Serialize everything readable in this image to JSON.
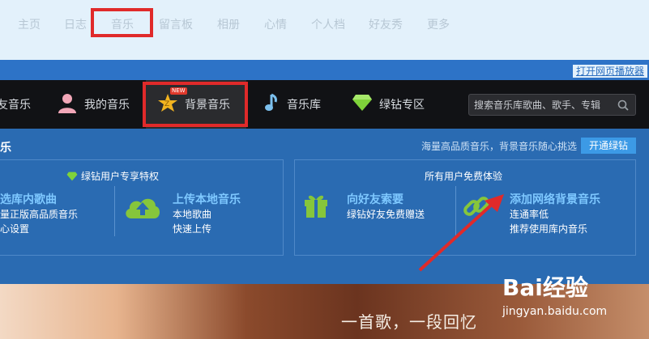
{
  "top_nav": {
    "items": [
      "主页",
      "日志",
      "音乐",
      "留言板",
      "相册",
      "心情",
      "个人档",
      "好友秀",
      "更多"
    ],
    "active_index": 2
  },
  "player_link": "打开网页播放器",
  "music_nav": {
    "items": [
      {
        "label": "友音乐",
        "icon": "friend-music-icon"
      },
      {
        "label": "我的音乐",
        "icon": "user-icon"
      },
      {
        "label": "背景音乐",
        "icon": "star-icon",
        "badge": "NEW"
      },
      {
        "label": "音乐库",
        "icon": "music-note-icon"
      },
      {
        "label": "绿钻专区",
        "icon": "diamond-icon"
      }
    ],
    "active_index": 2,
    "search_placeholder": "搜索音乐库歌曲、歌手、专辑"
  },
  "panel": {
    "title": "乐",
    "promo_text": "海量高品质音乐，背景音乐随心挑选",
    "promo_button": "开通绿钻",
    "left_card": {
      "header": "绿钻用户专享特权",
      "features": [
        {
          "title": "选库内歌曲",
          "lines": [
            "量正版高品质音乐",
            "心设置"
          ]
        },
        {
          "title": "上传本地音乐",
          "lines": [
            "本地歌曲",
            "快速上传"
          ],
          "icon": "upload-cloud-icon"
        }
      ]
    },
    "right_card": {
      "header": "所有用户免费体验",
      "features": [
        {
          "title": "向好友索要",
          "lines": [
            "绿钻好友免费赠送"
          ],
          "icon": "gift-icon"
        },
        {
          "title": "添加网络背景音乐",
          "lines": [
            "连通率低",
            "推荐使用库内音乐"
          ],
          "icon": "link-icon"
        }
      ]
    }
  },
  "banner": {
    "text": "一首歌，一段回忆",
    "watermark": "Bai经验",
    "watermark_url": "jingyan.baidu.com"
  },
  "colors": {
    "highlight_red": "#e02a2a",
    "panel_blue": "#2a6bb2",
    "link_blue": "#7ec8ff",
    "toolbar_black": "#111215"
  }
}
